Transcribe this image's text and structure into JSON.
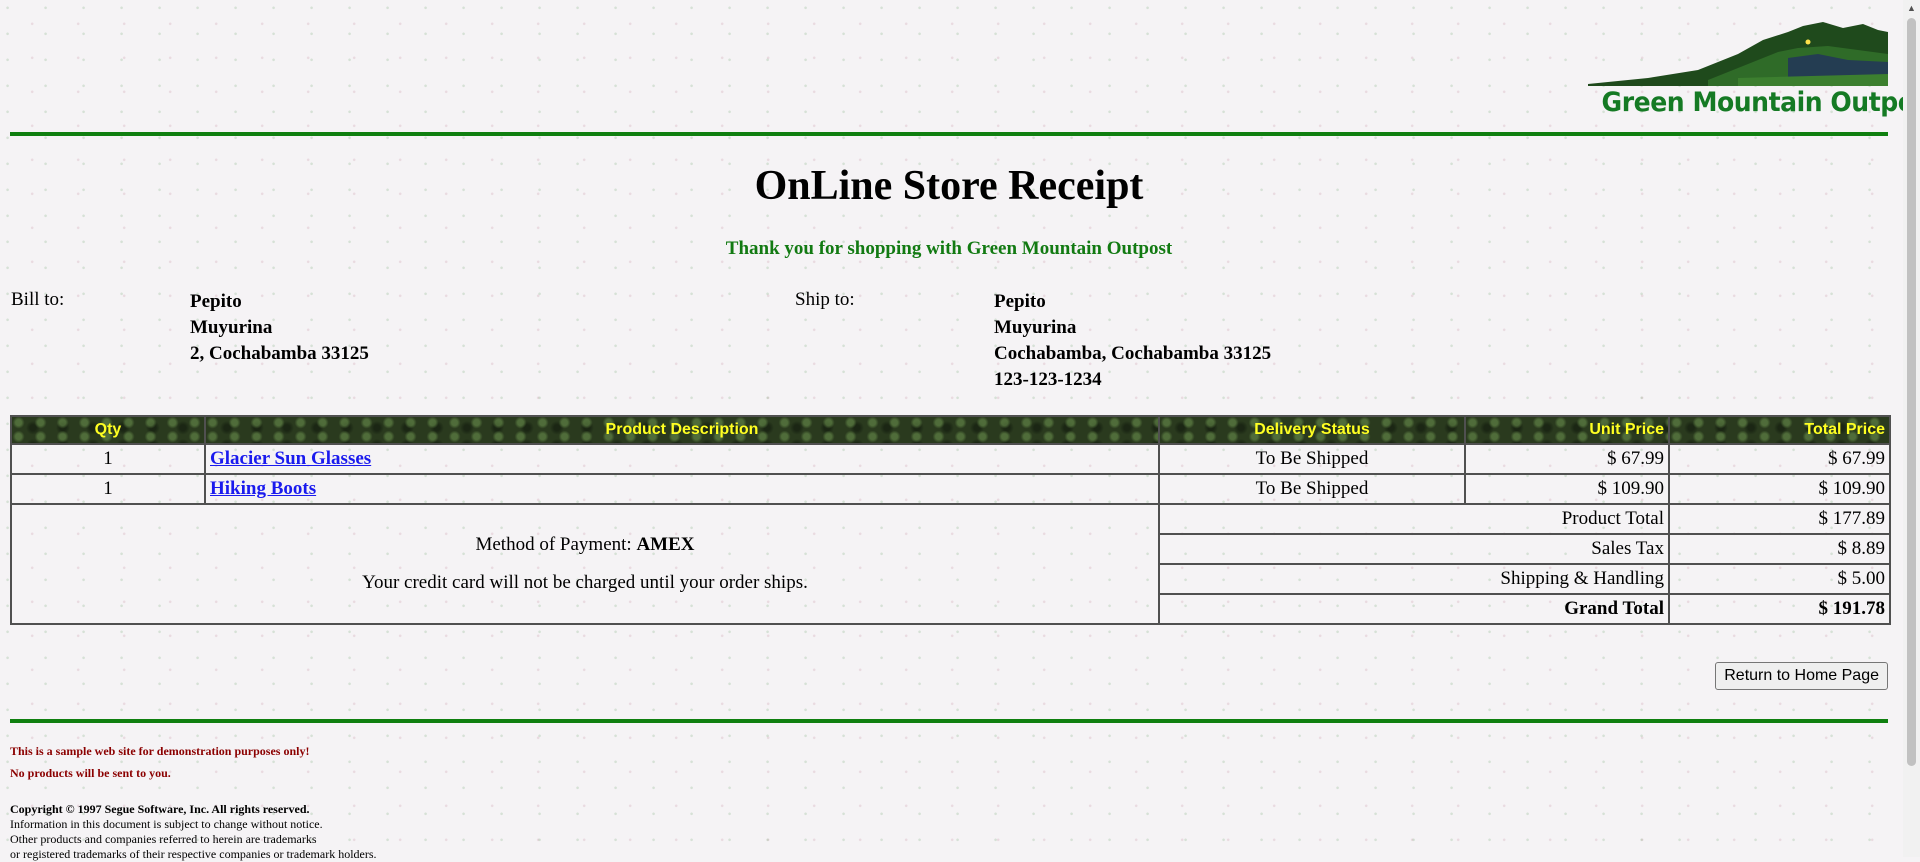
{
  "header": {
    "logo_text": "Green Mountain Outpost"
  },
  "page_title": "OnLine Store Receipt",
  "thanks_message": "Thank you for shopping with Green Mountain Outpost",
  "bill_to": {
    "label": "Bill to:",
    "lines": [
      "Pepito",
      "Muyurina",
      "2, Cochabamba 33125"
    ]
  },
  "ship_to": {
    "label": "Ship to:",
    "lines": [
      "Pepito",
      "Muyurina",
      "Cochabamba, Cochabamba 33125",
      "123-123-1234"
    ]
  },
  "table": {
    "headers": {
      "qty": "Qty",
      "description": "Product Description",
      "delivery": "Delivery Status",
      "unit_price": "Unit Price",
      "total_price": "Total Price"
    },
    "rows": [
      {
        "qty": "1",
        "description": "Glacier Sun Glasses",
        "delivery": "To Be Shipped",
        "unit_price": "$ 67.99",
        "total_price": "$ 67.99"
      },
      {
        "qty": "1",
        "description": "Hiking Boots",
        "delivery": "To Be Shipped",
        "unit_price": "$ 109.90",
        "total_price": "$ 109.90"
      }
    ],
    "payment": {
      "label": "Method of Payment:",
      "method": "AMEX",
      "note": "Your credit card will not be charged until your order ships."
    },
    "totals": [
      {
        "label": "Product Total",
        "value": "$ 177.89"
      },
      {
        "label": "Sales Tax",
        "value": "$ 8.89"
      },
      {
        "label": "Shipping & Handling",
        "value": "$ 5.00"
      },
      {
        "label": "Grand Total",
        "value": "$ 191.78"
      }
    ]
  },
  "home_button_label": "Return to Home Page",
  "footer": {
    "disclaimer_1": "This is a sample web site for demonstration purposes only!",
    "disclaimer_2": "No products will be sent to you.",
    "copyright": "Copyright © 1997 Segue Software, Inc. All rights reserved.",
    "notice_1": "Information in this document is subject to change without notice.",
    "notice_2": "Other products and companies referred to herein are trademarks",
    "notice_3": "or registered trademarks of their respective companies or trademark holders."
  },
  "colors": {
    "rule": "#0f7f0f",
    "brand_green": "#157a24",
    "header_text": "#ffff22",
    "link": "#1a1aee",
    "disclaimer": "#8b0000"
  }
}
